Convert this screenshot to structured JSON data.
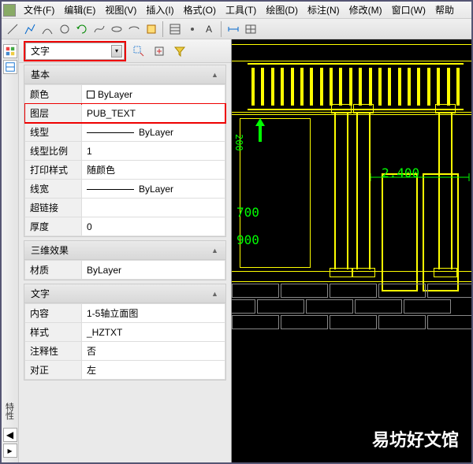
{
  "menu": {
    "items": [
      "文件(F)",
      "编辑(E)",
      "视图(V)",
      "插入(I)",
      "格式(O)",
      "工具(T)",
      "绘图(D)",
      "标注(N)",
      "修改(M)",
      "窗口(W)",
      "帮助"
    ]
  },
  "selection": {
    "type": "文字"
  },
  "groups": {
    "basic": {
      "title": "基本",
      "rows": [
        {
          "label": "颜色",
          "value": "ByLayer",
          "swatch": true
        },
        {
          "label": "图层",
          "value": "PUB_TEXT",
          "hl": true
        },
        {
          "label": "线型",
          "value": "ByLayer",
          "line": true
        },
        {
          "label": "线型比例",
          "value": "1"
        },
        {
          "label": "打印样式",
          "value": "随颜色"
        },
        {
          "label": "线宽",
          "value": "ByLayer",
          "line": true
        },
        {
          "label": "超链接",
          "value": ""
        },
        {
          "label": "厚度",
          "value": "0"
        }
      ]
    },
    "threed": {
      "title": "三维效果",
      "rows": [
        {
          "label": "材质",
          "value": "ByLayer"
        }
      ]
    },
    "text": {
      "title": "文字",
      "rows": [
        {
          "label": "内容",
          "value": "1-5轴立面图"
        },
        {
          "label": "样式",
          "value": "_HZTXT"
        },
        {
          "label": "注释性",
          "value": "否"
        },
        {
          "label": "对正",
          "value": "左"
        }
      ]
    }
  },
  "dims": {
    "d1": "2.400",
    "d2": "700",
    "d3": "900",
    "d4": "200"
  },
  "watermark": "易坊好文馆",
  "sidebar": {
    "label": "特性"
  }
}
